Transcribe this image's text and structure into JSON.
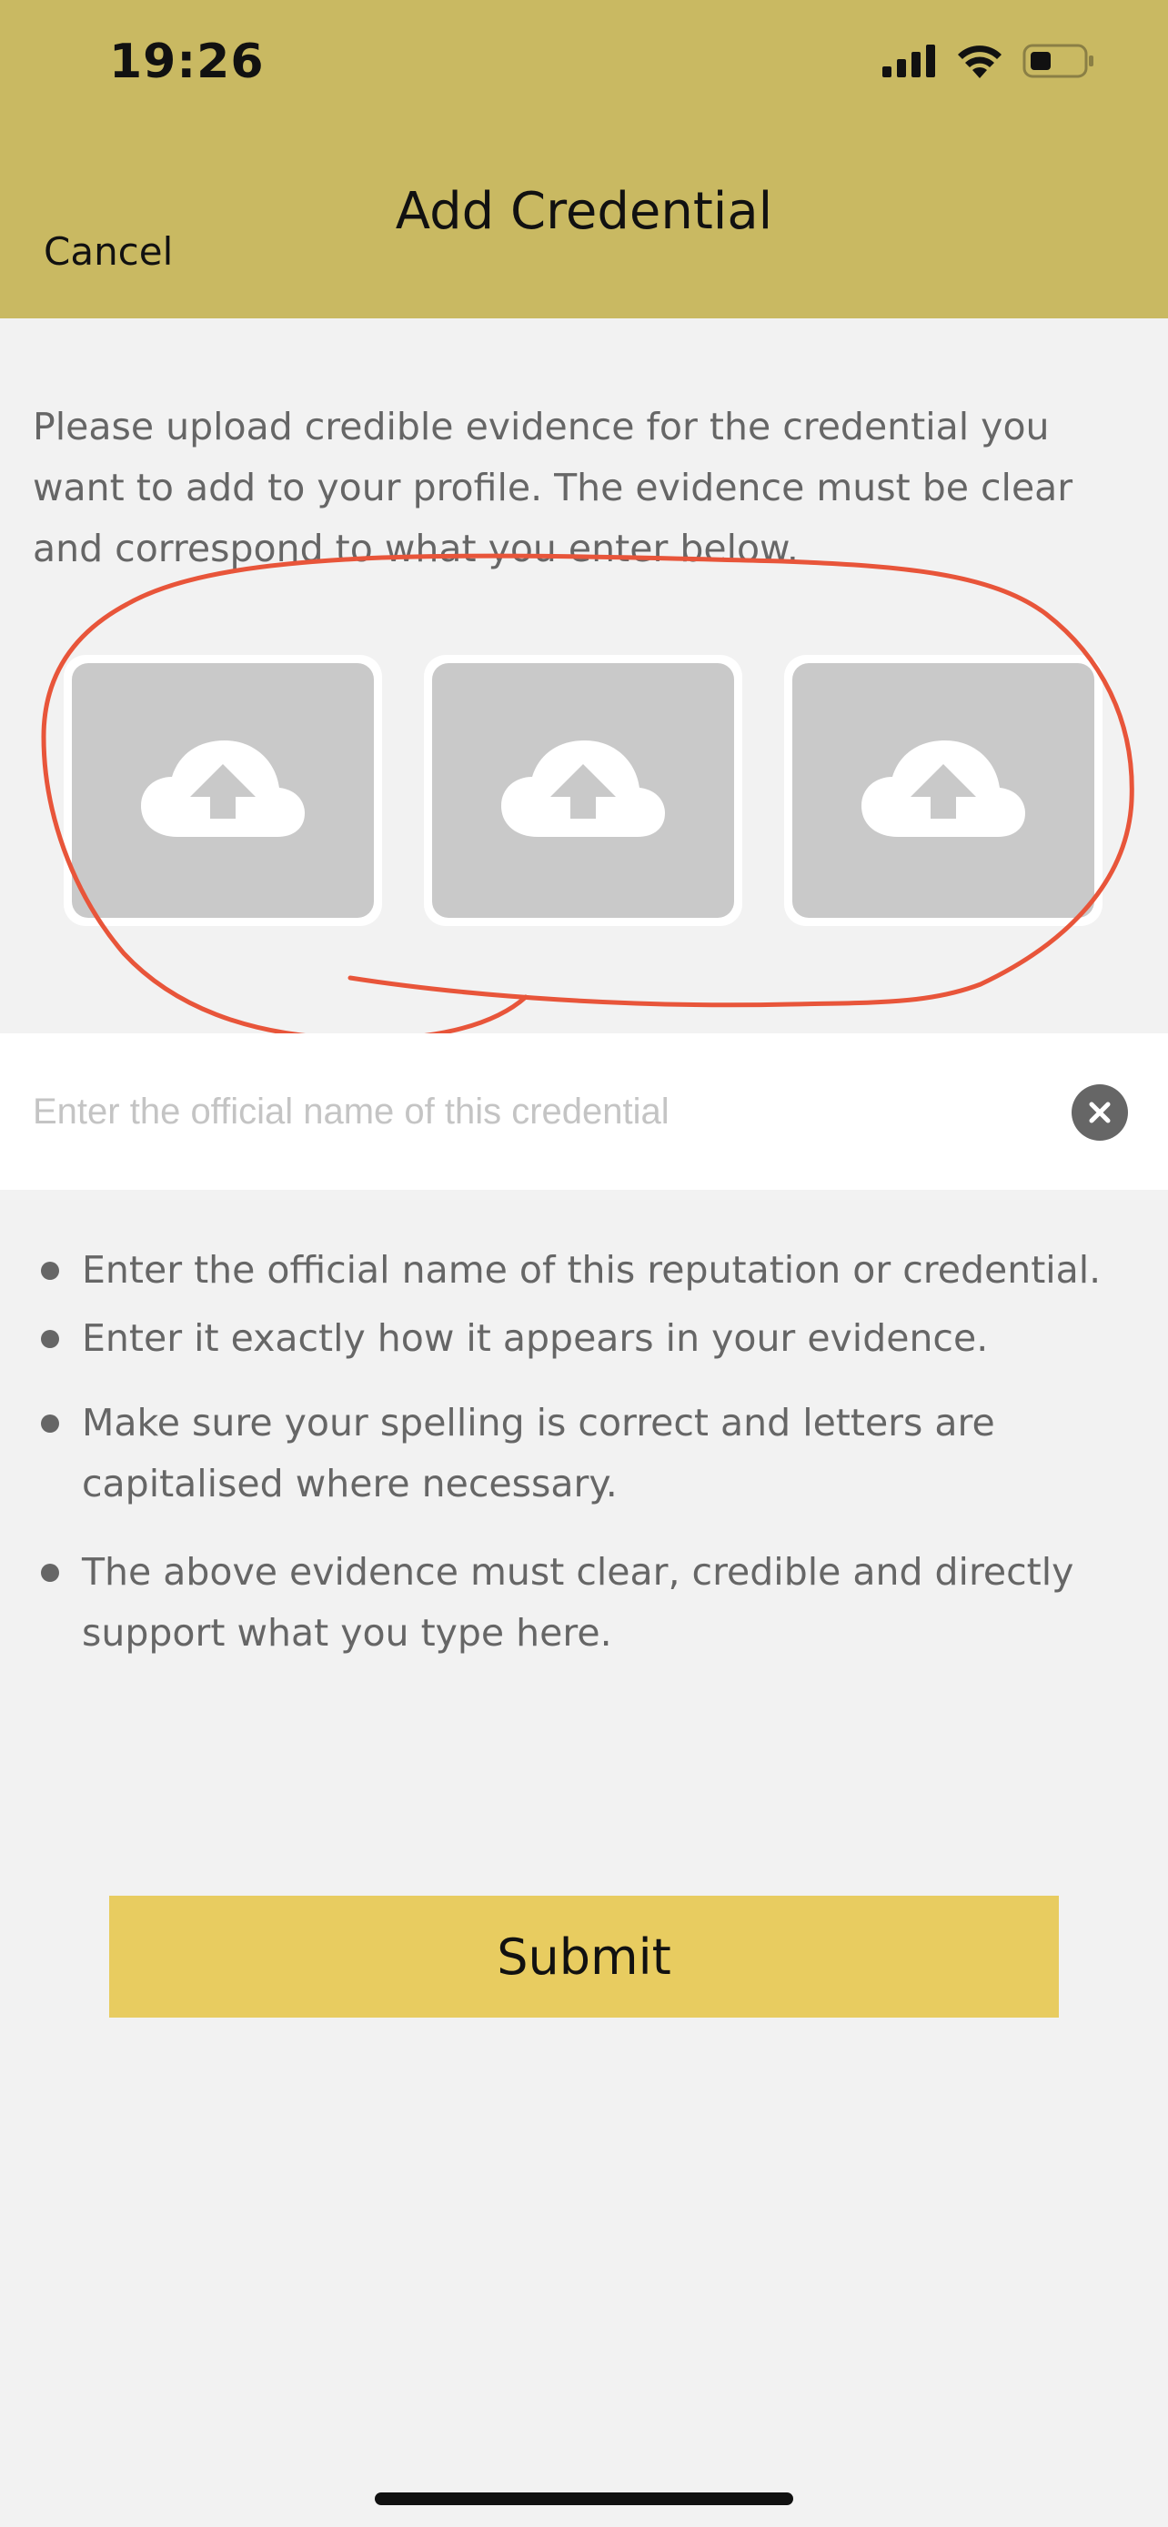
{
  "status_bar": {
    "time": "19:26",
    "icons": [
      "cellular-signal-icon",
      "wifi-icon",
      "battery-icon"
    ]
  },
  "nav": {
    "title": "Add Credential",
    "cancel_label": "Cancel"
  },
  "intro_text": "Please upload credible evidence for the credential you want to add to your profile. The evidence must be clear and correspond to what you enter below.",
  "upload_slots": [
    {
      "icon": "cloud-upload-icon"
    },
    {
      "icon": "cloud-upload-icon"
    },
    {
      "icon": "cloud-upload-icon"
    }
  ],
  "name_field": {
    "value": "",
    "placeholder": "Enter the official name of this credential",
    "clear_icon": "clear-icon"
  },
  "guidelines": [
    "Enter the official name of this reputation or credential.",
    "Enter it exactly how it appears in your evidence.",
    "Make sure your spelling is correct and letters are capitalised where necessary.",
    "The above evidence must clear, credible and directly support what you type here."
  ],
  "submit_label": "Submit",
  "colors": {
    "header": "#c9b962",
    "background": "#f2f2f2",
    "submit": "#e8cc60",
    "annotation": "#e8553a",
    "upload_tile": "#c9c9c9"
  }
}
